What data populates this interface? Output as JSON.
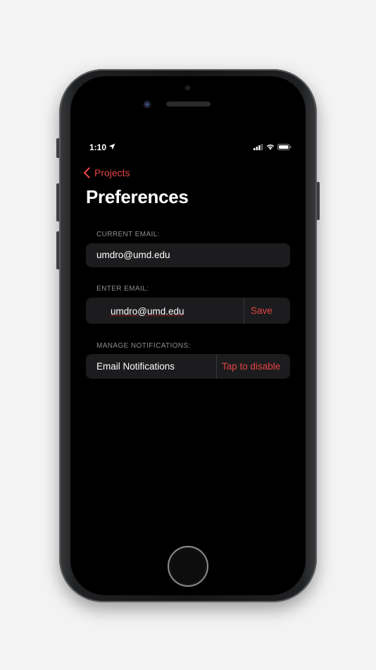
{
  "status_bar": {
    "time": "1:10"
  },
  "nav": {
    "back_label": "Projects"
  },
  "page": {
    "title": "Preferences"
  },
  "current_email": {
    "header": "CURRENT EMAIL:",
    "value": "umdro@umd.edu"
  },
  "enter_email": {
    "header": "ENTER EMAIL:",
    "value": "umdro@umd.edu",
    "save_label": "Save"
  },
  "notifications": {
    "header": "MANAGE NOTIFICATIONS:",
    "label": "Email Notifications",
    "action_label": "Tap to disable"
  },
  "colors": {
    "accent": "#e54343",
    "background": "#000000",
    "card": "#1c1c1e",
    "section_header": "#8e8e93"
  }
}
